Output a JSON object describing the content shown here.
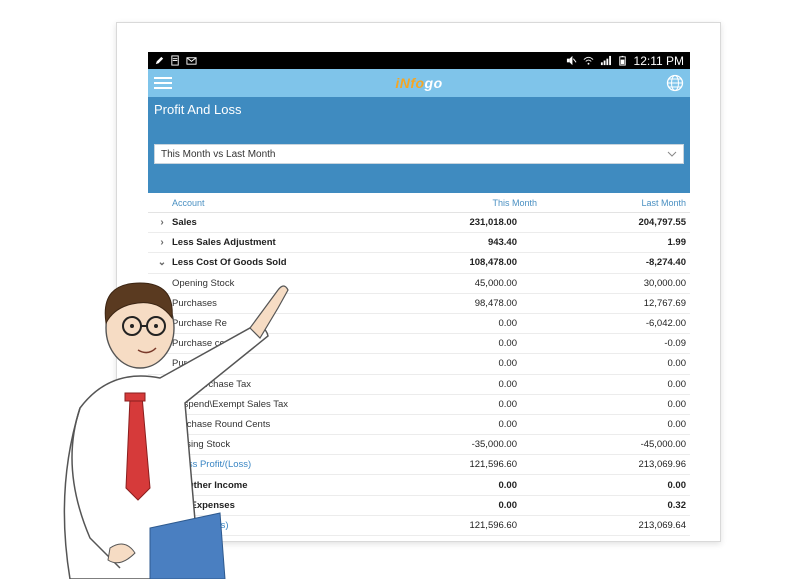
{
  "status_bar": {
    "time": "12:11 PM",
    "left_icons": [
      "pencil-icon",
      "doc-icon",
      "mail-icon"
    ],
    "right_icons": [
      "mute-icon",
      "wifi-icon",
      "signal-icon",
      "battery-icon"
    ]
  },
  "app_bar": {
    "logo_prefix": "iNfo",
    "logo_suffix": "go",
    "menu_icon": "hamburger-icon",
    "globe_icon": "globe-icon"
  },
  "panel": {
    "title": "Profit And Loss",
    "period_select": "This Month vs Last Month"
  },
  "table": {
    "headers": {
      "account": "Account",
      "this_month": "This Month",
      "last_month": "Last Month"
    },
    "rows": [
      {
        "label": "Sales",
        "this_month": "231,018.00",
        "last_month": "204,797.55",
        "chev": "›",
        "style": "bold"
      },
      {
        "label": "Less Sales Adjustment",
        "this_month": "943.40",
        "last_month": "1.99",
        "chev": "›",
        "style": "bold"
      },
      {
        "label": "Less Cost Of Goods Sold",
        "this_month": "108,478.00",
        "last_month": "-8,274.40",
        "chev": "⌄",
        "style": "bold"
      },
      {
        "label": "Opening Stock",
        "this_month": "45,000.00",
        "last_month": "30,000.00",
        "chev": "",
        "style": "sub"
      },
      {
        "label": "Purchases",
        "this_month": "98,478.00",
        "last_month": "12,767.69",
        "chev": "",
        "style": "sub"
      },
      {
        "label": "Purchase Re",
        "this_month": "0.00",
        "last_month": "-6,042.00",
        "chev": "",
        "style": "sub"
      },
      {
        "label": "Purchase      ccounts",
        "this_month": "0.00",
        "last_month": "-0.09",
        "chev": "",
        "style": "sub"
      },
      {
        "label": "Pur      e Tax",
        "this_month": "0.00",
        "last_month": "0.00",
        "chev": "",
        "style": "sub"
      },
      {
        "label": "dard Purchase Tax",
        "this_month": "0.00",
        "last_month": "0.00",
        "chev": "",
        "style": "sub"
      },
      {
        "label": "Suspend\\Exempt Sales Tax",
        "this_month": "0.00",
        "last_month": "0.00",
        "chev": "",
        "style": "sub"
      },
      {
        "label": "Purchase Round Cents",
        "this_month": "0.00",
        "last_month": "0.00",
        "chev": "",
        "style": "sub"
      },
      {
        "label": "Closing Stock",
        "this_month": "-35,000.00",
        "last_month": "-45,000.00",
        "chev": "",
        "style": "sub"
      },
      {
        "label": "Gross Profit/(Loss)",
        "this_month": "121,596.60",
        "last_month": "213,069.96",
        "chev": "",
        "style": "total"
      },
      {
        "label": "dd Other Income",
        "this_month": "0.00",
        "last_month": "0.00",
        "chev": "",
        "style": "bold"
      },
      {
        "label": "ess Expenses",
        "this_month": "0.00",
        "last_month": "0.32",
        "chev": "",
        "style": "bold"
      },
      {
        "label": "t Profit/(Loss)",
        "this_month": "121,596.60",
        "last_month": "213,069.64",
        "chev": "",
        "style": "total"
      }
    ]
  },
  "colors": {
    "appbar": "#7fc4ea",
    "panel": "#3f8bc0",
    "header_text": "#4a90c2",
    "logo_orange": "#f5a623"
  }
}
